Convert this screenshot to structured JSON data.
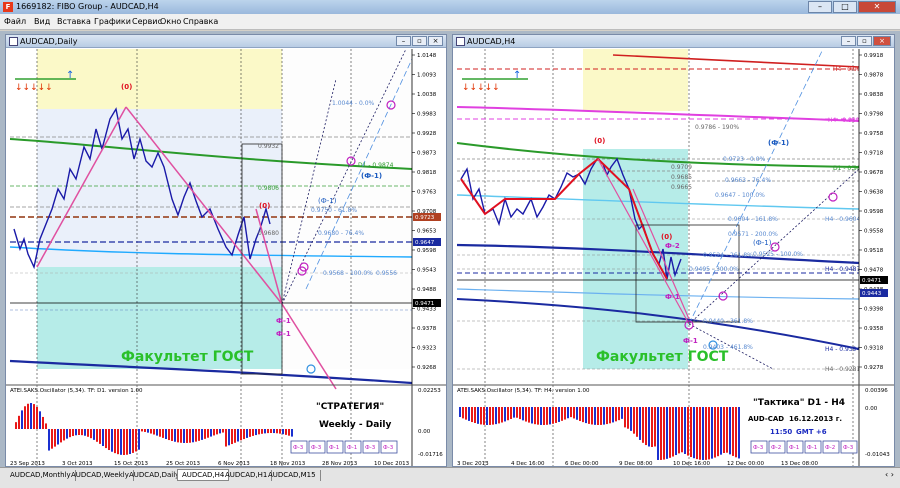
{
  "window": {
    "title": "1669182: FIBO Group - AUDCAD,H4",
    "icon": "F"
  },
  "menu": [
    "Файл",
    "Вид",
    "Вставка",
    "Графики",
    "Сервис",
    "Окно",
    "Справка"
  ],
  "left": {
    "title": "AUDCAD,Daily",
    "prices": [
      "1.0148",
      "1.0093",
      "1.0038",
      "0.9983",
      "0.9928",
      "0.9873",
      "0.9818",
      "0.9763",
      "0.9708",
      "0.9653",
      "0.9598",
      "0.9543",
      "0.9488",
      "0.9433",
      "0.9378",
      "0.9323",
      "0.9268"
    ],
    "price_boxes": [
      {
        "text": "0.9723",
        "color": "#b04020"
      },
      {
        "text": "0.9647",
        "color": "#1a2aa0"
      },
      {
        "text": "0.9471",
        "color": "#000000"
      }
    ],
    "levels": {
      "l1004": "1.0044 - 0.0%",
      "l9932": "0.9932",
      "d1": "D1 - 0.9874",
      "phi1": "(Ф-1)",
      "l9806": "0.9806",
      "l50": "(Ф-1)",
      "l9750": "0.9750 - 61.8%",
      "l9680": "0.9680",
      "l9680b": "0.9680 - 76.4%",
      "l9568": "0.9568 - 100.0%",
      "l9556": "0.9556"
    },
    "labels": {
      "zero_top": "(0)",
      "zero_right": "(0)",
      "phi_low1": "Ф-1",
      "phi_low2": "Ф-1",
      "watermark": "Факультет ГОСТ"
    },
    "indicator": {
      "title": "ATEI.SAKS.Oscillator (5,34). TF: D1. version 1.00",
      "scale": [
        "0.02253",
        "0.00",
        "-0.01716"
      ],
      "caption1": "\"СТРАТЕГИЯ\"",
      "caption2": "Weekly - Daily",
      "buttons": [
        "Ф-3",
        "Ф-3",
        "Ф-1",
        "Ф-1",
        "Ф-3",
        "Ф-3"
      ]
    },
    "dates": [
      "23 Sep 2013",
      "3 Oct 2013",
      "15 Oct 2013",
      "25 Oct 2013",
      "6 Nov 2013",
      "18 Nov 2013",
      "28 Nov 2013",
      "10 Dec 2013"
    ]
  },
  "right": {
    "title": "AUDCAD,H4",
    "prices": [
      "0.9918",
      "0.9878",
      "0.9838",
      "0.9798",
      "0.9758",
      "0.9718",
      "0.9678",
      "0.9638",
      "0.9598",
      "0.9558",
      "0.9518",
      "0.9478",
      "0.9438",
      "0.9398",
      "0.9358",
      "0.9318",
      "0.9278"
    ],
    "price_boxes": [
      {
        "text": "0.9471",
        "color": "#000000"
      },
      {
        "text": "0.9443",
        "color": "#1a2aa0"
      }
    ],
    "levels": {
      "h4a": "H4 - 0.9901",
      "h4b": "H4 - 0.9807",
      "l9786": "0.9786 - 190%",
      "phi1": "(Ф-1)",
      "l9723": "0.9723 - 0.0%",
      "l9709": "0.9709",
      "l9685": "0.9685",
      "l9665": "0.9665",
      "l9663": "0.9663 - 76.4%",
      "l9647": "0.9647 - 100.0%",
      "l9604": "0.9604 - 161.8%",
      "h4c": "H4 - 0.9604",
      "l9571": "0.9571 - 200.0%",
      "phi1b": "(Ф-1)",
      "l9524": "0.9524 - 261.8%",
      "l9525": "0.9525 - 100.0%",
      "l9495": "0.9495 - 300.0%",
      "h4d": "H4 - 0.9487",
      "l9440": "0.9440 - 361.8%",
      "l9400": "0.9403 - 461.8%",
      "h4e": "H4 - 0.9394",
      "h4f": "H4 - 0.9281",
      "d1": "D1 - 0.9874"
    },
    "labels": {
      "zero_a": "(0)",
      "zero_b": "(0)",
      "phi2": "Ф-2",
      "phi1": "Ф-1",
      "phi1b": "Ф-1",
      "watermark": "Факультет ГОСТ"
    },
    "indicator": {
      "title": "ATEI.SAKS.Oscillator (5,34). TF: H4. version 1.00",
      "scale": [
        "0.00396",
        "0.00",
        "-0.01043"
      ],
      "caption1": "\"Тактика\"  D1 - H4",
      "pair": "AUD-CAD",
      "date": "16.12.2013  г.",
      "time": "11:50",
      "gmt": "GMT +6",
      "buttons": [
        "Ф-3",
        "Ф-2",
        "Ф-1",
        "Ф-1",
        "Ф-2",
        "Ф-3"
      ]
    },
    "dates": [
      "3 Dec 2013",
      "4 Dec 16:00",
      "6 Dec 00:00",
      "9 Dec 08:00",
      "10 Dec 16:00",
      "12 Dec 00:00",
      "13 Dec 08:00"
    ]
  },
  "tabs": [
    "AUDCAD,Monthly",
    "AUDCAD,Weekly",
    "AUDCAD,Daily",
    "AUDCAD,H4",
    "AUDCAD,H1",
    "AUDCAD,M15"
  ],
  "active_tab": "AUDCAD,H4"
}
